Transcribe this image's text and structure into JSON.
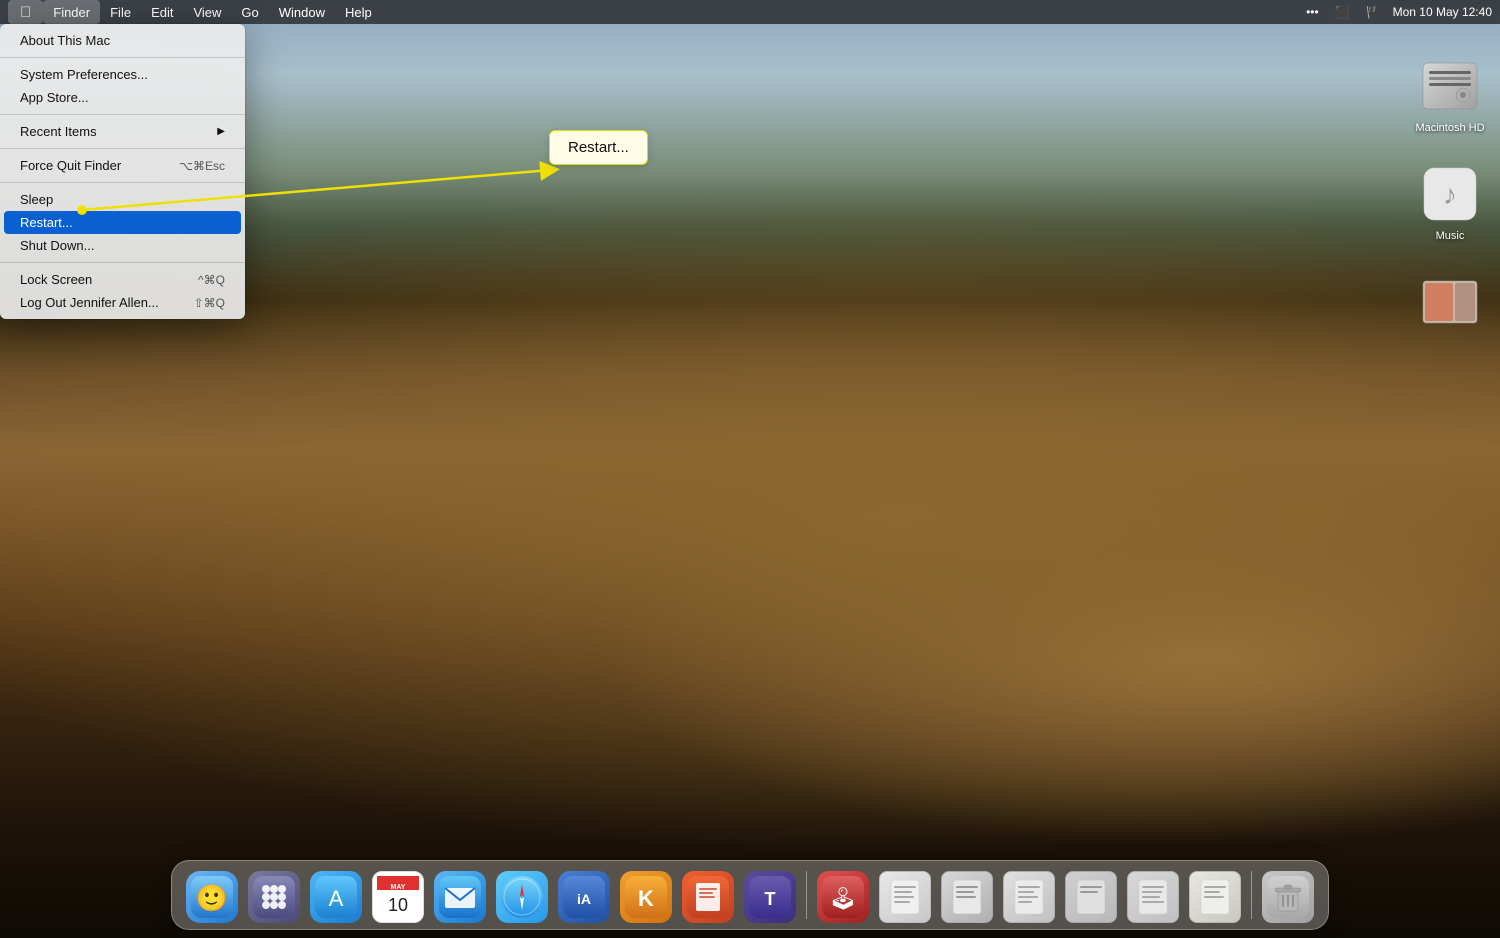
{
  "desktop": {
    "bg": "Mojave sand dunes"
  },
  "menubar": {
    "apple_label": "",
    "items": [
      {
        "label": "Finder",
        "active": true
      },
      {
        "label": "File"
      },
      {
        "label": "Edit"
      },
      {
        "label": "View"
      },
      {
        "label": "Go"
      },
      {
        "label": "Window"
      },
      {
        "label": "Help"
      }
    ],
    "right": {
      "datetime": "Mon 10 May  12:40",
      "icons": [
        "ellipsis",
        "screen",
        "flag"
      ]
    }
  },
  "apple_menu": {
    "items": [
      {
        "id": "about",
        "label": "About This Mac",
        "shortcut": "",
        "type": "item"
      },
      {
        "id": "sep1",
        "type": "separator"
      },
      {
        "id": "system_prefs",
        "label": "System Preferences...",
        "shortcut": "",
        "type": "item"
      },
      {
        "id": "app_store",
        "label": "App Store...",
        "shortcut": "",
        "type": "item"
      },
      {
        "id": "sep2",
        "type": "separator"
      },
      {
        "id": "recent_items",
        "label": "Recent Items",
        "shortcut": "",
        "type": "submenu",
        "arrow": "▶"
      },
      {
        "id": "sep3",
        "type": "separator"
      },
      {
        "id": "force_quit",
        "label": "Force Quit Finder",
        "shortcut": "⌥⌘Esc",
        "type": "item"
      },
      {
        "id": "sep4",
        "type": "separator"
      },
      {
        "id": "sleep",
        "label": "Sleep",
        "shortcut": "",
        "type": "item"
      },
      {
        "id": "restart",
        "label": "Restart...",
        "shortcut": "",
        "type": "item",
        "highlighted": true
      },
      {
        "id": "shut_down",
        "label": "Shut Down...",
        "shortcut": "",
        "type": "item"
      },
      {
        "id": "sep5",
        "type": "separator"
      },
      {
        "id": "lock_screen",
        "label": "Lock Screen",
        "shortcut": "^⌘Q",
        "type": "item"
      },
      {
        "id": "log_out",
        "label": "Log Out Jennifer Allen...",
        "shortcut": "⇧⌘Q",
        "type": "item"
      }
    ]
  },
  "restart_tooltip": {
    "label": "Restart..."
  },
  "desktop_icons": [
    {
      "id": "macintosh_hd",
      "label": "Macintosh HD",
      "type": "hd"
    },
    {
      "id": "music",
      "label": "Music",
      "type": "music"
    },
    {
      "id": "img3",
      "label": "",
      "type": "img"
    }
  ],
  "dock": {
    "items": [
      {
        "id": "finder",
        "label": "Finder",
        "type": "finder"
      },
      {
        "id": "launchpad",
        "label": "Launchpad",
        "type": "launchpad"
      },
      {
        "id": "appstore",
        "label": "App Store",
        "type": "appstore"
      },
      {
        "id": "calendar",
        "label": "Calendar",
        "type": "calendar",
        "badge": "10",
        "month": "MAY"
      },
      {
        "id": "mail",
        "label": "Mail",
        "type": "mail"
      },
      {
        "id": "safari",
        "label": "Safari",
        "type": "safari"
      },
      {
        "id": "ia_writer",
        "label": "iA Writer",
        "type": "ia_writer"
      },
      {
        "id": "keka",
        "label": "Keka",
        "type": "keka"
      },
      {
        "id": "pages",
        "label": "Pages",
        "type": "pages"
      },
      {
        "id": "teams",
        "label": "Teams",
        "type": "teams"
      },
      {
        "id": "sep"
      },
      {
        "id": "joystick",
        "label": "Joystick",
        "type": "joystick"
      },
      {
        "id": "doc1",
        "label": "",
        "type": "doc1"
      },
      {
        "id": "doc2",
        "label": "",
        "type": "doc2"
      },
      {
        "id": "doc3",
        "label": "",
        "type": "doc3"
      },
      {
        "id": "doc4",
        "label": "",
        "type": "doc4"
      },
      {
        "id": "doc5",
        "label": "",
        "type": "doc5"
      },
      {
        "id": "doc6",
        "label": "",
        "type": "doc6"
      },
      {
        "id": "sep2"
      },
      {
        "id": "trash",
        "label": "Trash",
        "type": "trash"
      }
    ]
  }
}
